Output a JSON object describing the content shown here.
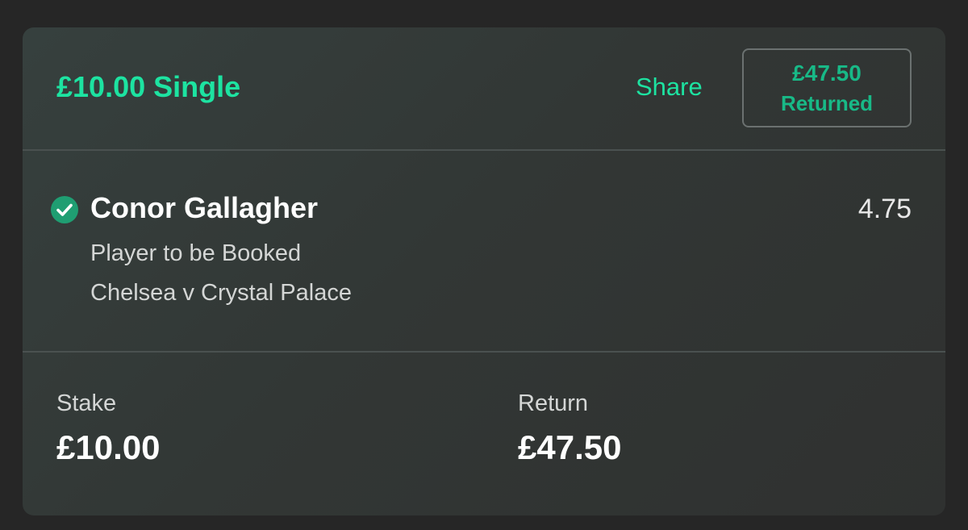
{
  "bet": {
    "title": "£10.00 Single",
    "share_label": "Share",
    "returned_amount": "£47.50",
    "returned_label": "Returned"
  },
  "selection": {
    "status_icon": "check-circle-icon",
    "runner": "Conor Gallagher",
    "odds": "4.75",
    "market": "Player to be Booked",
    "event": "Chelsea v Crystal Palace"
  },
  "summary": {
    "stake_label": "Stake",
    "stake_value": "£10.00",
    "return_label": "Return",
    "return_value": "£47.50"
  },
  "colors": {
    "accent": "#1de3a1",
    "returned_badge_text": "#18b987",
    "check_fill": "#1f9e72",
    "card_background": "#323735",
    "page_background": "#262626"
  }
}
